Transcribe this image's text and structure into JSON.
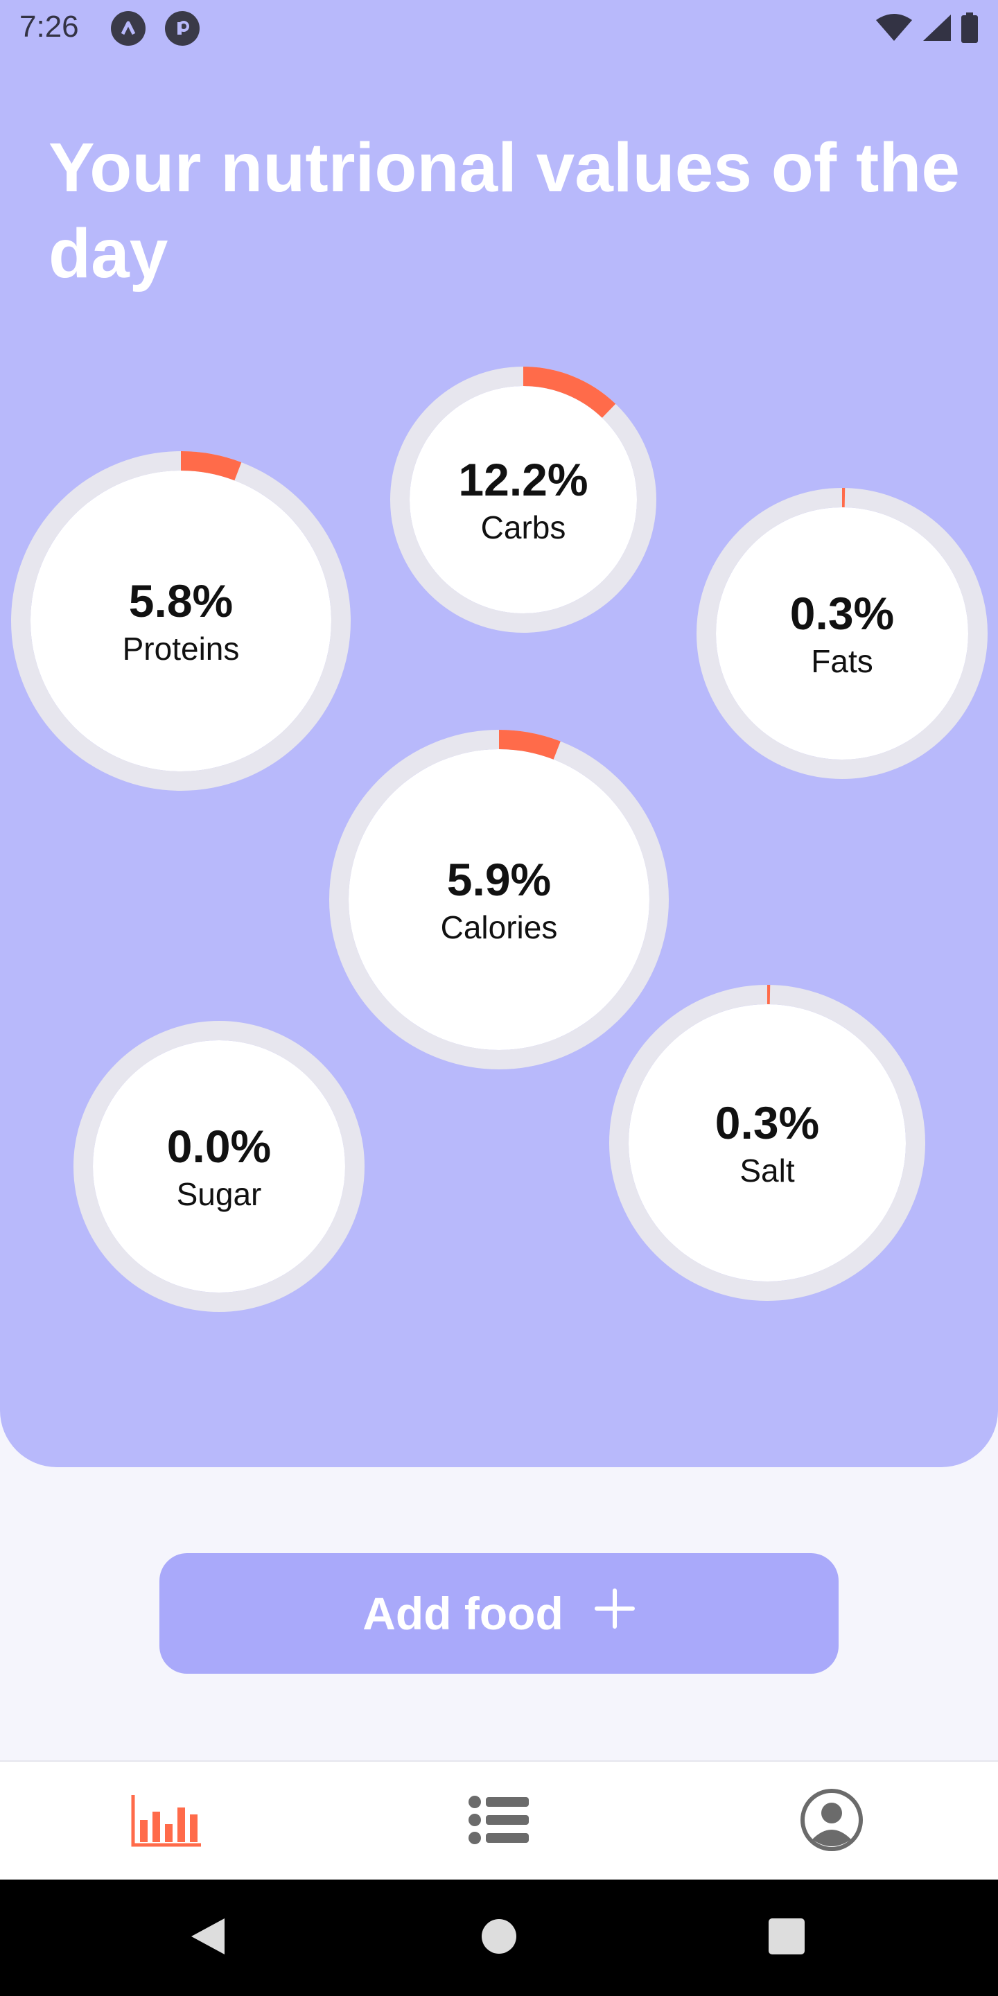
{
  "status_bar": {
    "time": "7:26",
    "icons": [
      "app-a-icon",
      "app-r-icon",
      "wifi-icon",
      "cellular-signal-icon",
      "battery-icon"
    ]
  },
  "header": {
    "title": "Your nutrional values of the day"
  },
  "colors": {
    "panel": "#b8b9fb",
    "progress": "#ff6b4a",
    "track": "#e7e6ee",
    "button": "#a9a9fa",
    "nav_active": "#ff6b4a",
    "nav_inactive": "#6b6b6b"
  },
  "nutrients": {
    "carbs": {
      "percent": "12.2%",
      "label": "Carbs",
      "value": 12.2
    },
    "proteins": {
      "percent": "5.8%",
      "label": "Proteins",
      "value": 5.8
    },
    "fats": {
      "percent": "0.3%",
      "label": "Fats",
      "value": 0.3
    },
    "calories": {
      "percent": "5.9%",
      "label": "Calories",
      "value": 5.9
    },
    "sugar": {
      "percent": "0.0%",
      "label": "Sugar",
      "value": 0.0
    },
    "salt": {
      "percent": "0.3%",
      "label": "Salt",
      "value": 0.3
    }
  },
  "add_food": {
    "label": "Add food",
    "icon": "plus-icon"
  },
  "bottom_nav": {
    "items": [
      {
        "icon": "bar-chart-icon",
        "active": true
      },
      {
        "icon": "list-icon",
        "active": false
      },
      {
        "icon": "account-circle-icon",
        "active": false
      }
    ]
  },
  "system_nav": {
    "icons": [
      "back-icon",
      "home-icon",
      "recents-icon"
    ]
  }
}
